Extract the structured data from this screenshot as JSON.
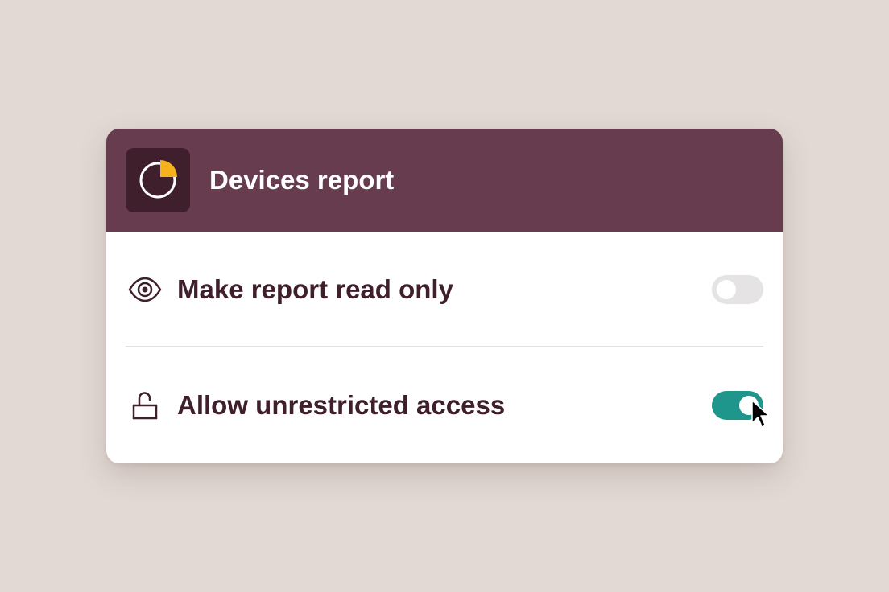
{
  "card": {
    "title": "Devices report",
    "app_icon": "pie-chart-icon"
  },
  "settings": [
    {
      "label": "Make report read only",
      "icon": "eye-icon",
      "toggle_on": false
    },
    {
      "label": "Allow unrestricted access",
      "icon": "unlocked-padlock-icon",
      "toggle_on": true
    }
  ],
  "colors": {
    "background": "#e2d9d4",
    "header": "#673c4f",
    "icon_tile": "#3f1f2c",
    "accent_yellow": "#f5b21c",
    "text_dark": "#3f1f2c",
    "toggle_on": "#1f968b",
    "toggle_off": "#e5e3e3"
  },
  "cursor": "arrow-pointer-icon"
}
